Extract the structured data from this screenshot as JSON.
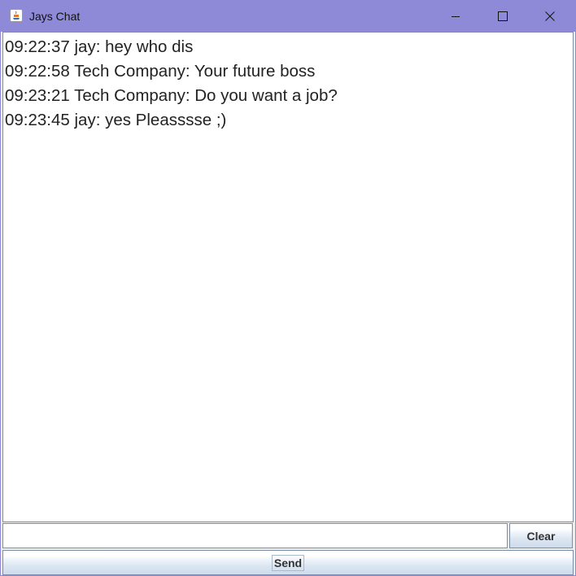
{
  "window": {
    "title": "Jays Chat",
    "titlebar_color": "#8e8ad8"
  },
  "titlebar_buttons": {
    "minimize_icon": "minimize-icon",
    "maximize_icon": "maximize-icon",
    "close_icon": "close-icon"
  },
  "chat": {
    "messages": [
      "09:22:37 jay: hey who dis",
      "09:22:58 Tech Company: Your future boss",
      "09:23:21 Tech Company: Do you want a job?",
      "09:23:45 jay: yes Pleasssse ;)"
    ]
  },
  "input": {
    "value": ""
  },
  "buttons": {
    "clear_label": "Clear",
    "send_label": "Send"
  }
}
